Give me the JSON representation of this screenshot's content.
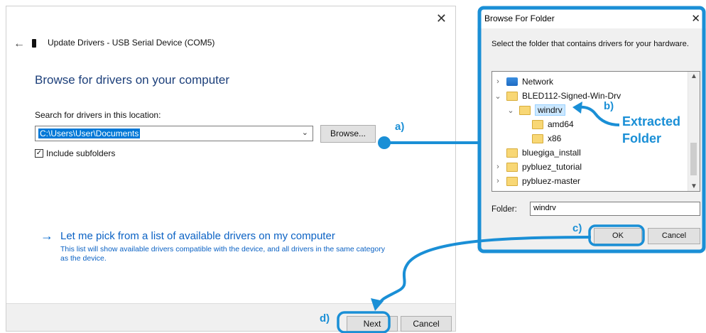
{
  "wizard": {
    "title": "Update Drivers - USB Serial Device (COM5)",
    "heading": "Browse for drivers on your computer",
    "search_label": "Search for drivers in this location:",
    "path_value": "C:\\Users\\User\\Documents",
    "browse_label": "Browse...",
    "include_subfolders_label": "Include subfolders",
    "include_subfolders_checked": true,
    "pick_link": "Let me pick from a list of available drivers on my computer",
    "pick_desc": "This list will show available drivers compatible with the device, and all drivers in the same category as the device.",
    "next_label": "Next",
    "cancel_label": "Cancel",
    "close_glyph": "✕",
    "back_glyph": "←",
    "arrow_glyph": "→",
    "check_glyph": "✓"
  },
  "browse_dialog": {
    "title": "Browse For Folder",
    "instruction": "Select the folder that contains drivers for your hardware.",
    "tree": [
      {
        "label": "Network",
        "icon": "network-icon",
        "chevron": "›"
      },
      {
        "label": "BLED112-Signed-Win-Drv",
        "icon": "folder-icon",
        "chevron": "⌄"
      },
      {
        "label": "windrv",
        "icon": "folder-icon",
        "chevron": "⌄",
        "selected": true
      },
      {
        "label": "amd64",
        "icon": "folder-icon",
        "chevron": ""
      },
      {
        "label": "x86",
        "icon": "folder-icon",
        "chevron": ""
      },
      {
        "label": "bluegiga_install",
        "icon": "folder-icon",
        "chevron": ""
      },
      {
        "label": "pybluez_tutorial",
        "icon": "folder-icon",
        "chevron": "›"
      },
      {
        "label": "pybluez-master",
        "icon": "folder-icon",
        "chevron": "›"
      }
    ],
    "folder_label": "Folder:",
    "folder_value": "windrv",
    "ok_label": "OK",
    "cancel_label": "Cancel",
    "close_glyph": "✕",
    "scroll_up_glyph": "▲",
    "scroll_down_glyph": "▼"
  },
  "annotations": {
    "a": "a)",
    "b": "b)",
    "c": "c)",
    "d": "d)",
    "extracted": "Extracted",
    "folder": "Folder",
    "color": "#1a8fd6"
  }
}
